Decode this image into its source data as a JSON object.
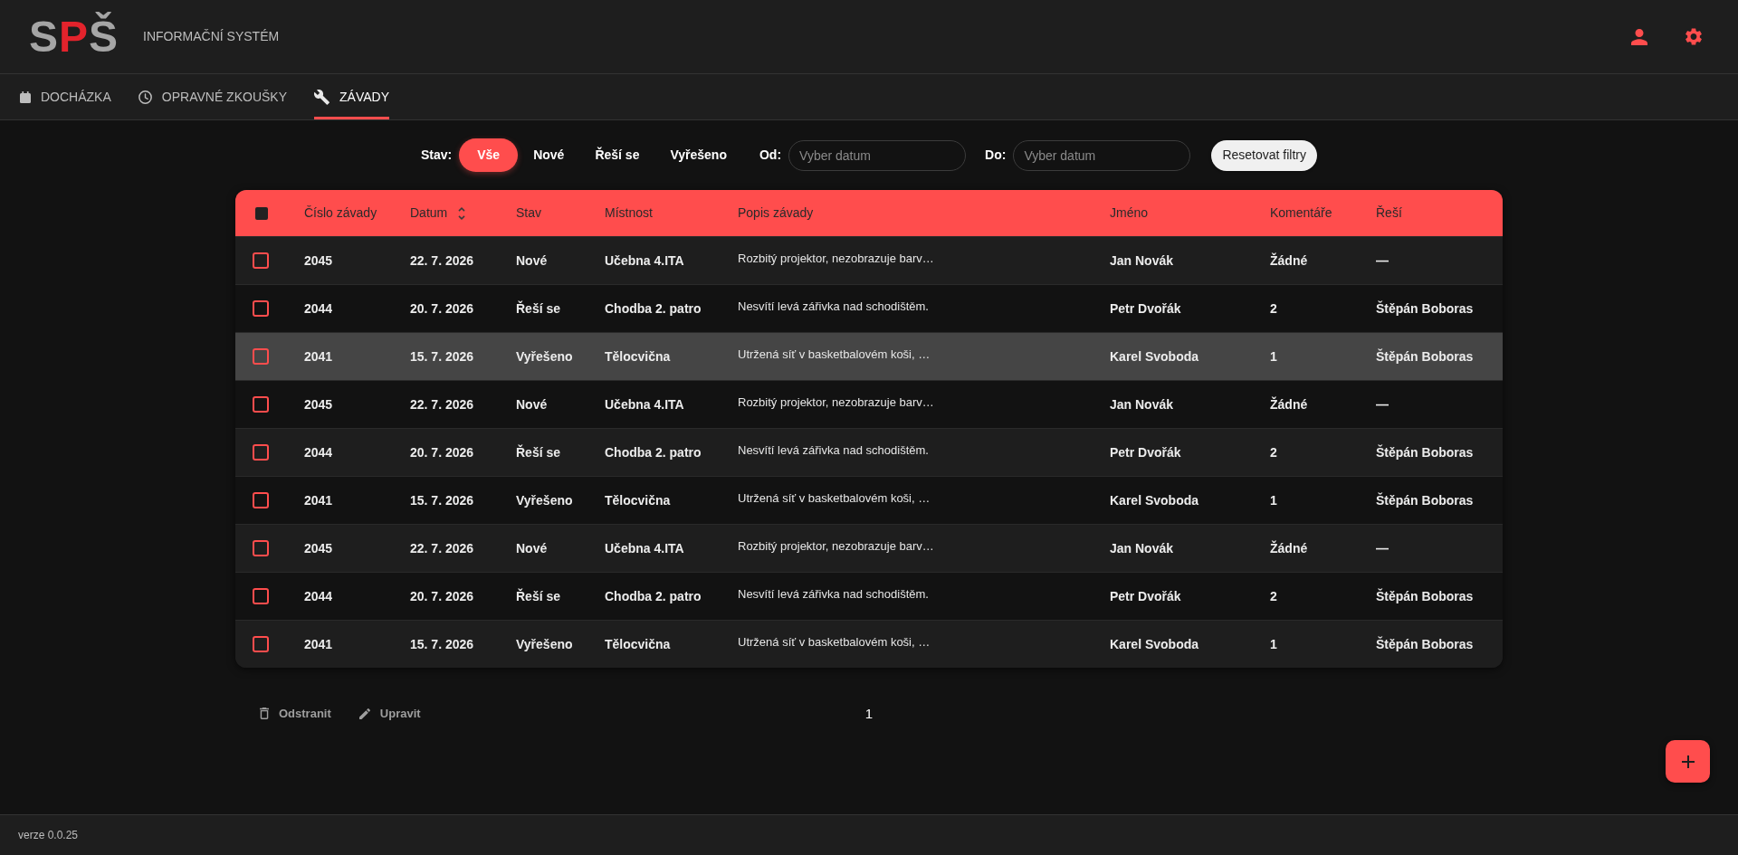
{
  "header": {
    "logo": [
      {
        "text": "S",
        "accent": false
      },
      {
        "text": "P",
        "accent": true
      },
      {
        "text": "Š",
        "accent": false
      }
    ],
    "title": "INFORMAČNÍ SYSTÉM"
  },
  "tabs": [
    {
      "label": "DOCHÁZKA",
      "kind": "calendar",
      "selected": false
    },
    {
      "label": "OPRAVNÉ ZKOUŠKY",
      "kind": "clock",
      "selected": false
    },
    {
      "label": "ZÁVADY",
      "kind": "wrench",
      "selected": true
    }
  ],
  "filters": {
    "status_label": "Stav:",
    "statuses": [
      {
        "label": "Vše",
        "selected": true
      },
      {
        "label": "Nové",
        "selected": false
      },
      {
        "label": "Řeší se",
        "selected": false
      },
      {
        "label": "Vyřešeno",
        "selected": false
      }
    ],
    "date_from": {
      "label": "Od:",
      "placeholder": "Vyber datum"
    },
    "date_to": {
      "label": "Do:",
      "placeholder": "Vyber datum"
    },
    "reset_button": "Resetovat filtry"
  },
  "table": {
    "select_all": {
      "checked": false
    },
    "columns": [
      {
        "label": "Číslo závady",
        "kind": "text",
        "sortable": false
      },
      {
        "label": "Datum",
        "kind": "text",
        "sortable": true
      },
      {
        "label": "Stav",
        "kind": "text",
        "sortable": false
      },
      {
        "label": "Místnost",
        "kind": "text",
        "sortable": false
      },
      {
        "label": "Popis závady",
        "kind": "description",
        "sortable": false
      },
      {
        "label": "Jméno",
        "kind": "text",
        "sortable": false
      },
      {
        "label": "Komentáře",
        "kind": "text",
        "sortable": false
      },
      {
        "label": "Řeší",
        "kind": "text",
        "sortable": false
      }
    ],
    "rows": [
      {
        "checked": false,
        "hovered": false,
        "cells": [
          "2045",
          "22. 7. 2026",
          "Nové",
          "Učebna 4.ITA",
          "Rozbitý projektor, nezobrazuje barv…",
          "Jan Novák",
          "Žádné",
          "—"
        ]
      },
      {
        "checked": false,
        "hovered": false,
        "cells": [
          "2044",
          "20. 7. 2026",
          "Řeší se",
          "Chodba 2. patro",
          "Nesvítí levá zářivka nad schodištěm.",
          "Petr Dvořák",
          "2",
          "Štěpán Boboras"
        ]
      },
      {
        "checked": false,
        "hovered": true,
        "cells": [
          "2041",
          "15. 7. 2026",
          "Vyřešeno",
          "Tělocvična",
          "Utržená síť v basketbalovém koši, …",
          "Karel Svoboda",
          "1",
          "Štěpán Boboras"
        ]
      },
      {
        "checked": false,
        "hovered": false,
        "cells": [
          "2045",
          "22. 7. 2026",
          "Nové",
          "Učebna 4.ITA",
          "Rozbitý projektor, nezobrazuje barv…",
          "Jan Novák",
          "Žádné",
          "—"
        ]
      },
      {
        "checked": false,
        "hovered": false,
        "cells": [
          "2044",
          "20. 7. 2026",
          "Řeší se",
          "Chodba 2. patro",
          "Nesvítí levá zářivka nad schodištěm.",
          "Petr Dvořák",
          "2",
          "Štěpán Boboras"
        ]
      },
      {
        "checked": false,
        "hovered": false,
        "cells": [
          "2041",
          "15. 7. 2026",
          "Vyřešeno",
          "Tělocvična",
          "Utržená síť v basketbalovém koši, …",
          "Karel Svoboda",
          "1",
          "Štěpán Boboras"
        ]
      },
      {
        "checked": false,
        "hovered": false,
        "cells": [
          "2045",
          "22. 7. 2026",
          "Nové",
          "Učebna 4.ITA",
          "Rozbitý projektor, nezobrazuje barv…",
          "Jan Novák",
          "Žádné",
          "—"
        ]
      },
      {
        "checked": false,
        "hovered": false,
        "cells": [
          "2044",
          "20. 7. 2026",
          "Řeší se",
          "Chodba 2. patro",
          "Nesvítí levá zářivka nad schodištěm.",
          "Petr Dvořák",
          "2",
          "Štěpán Boboras"
        ]
      },
      {
        "checked": false,
        "hovered": false,
        "cells": [
          "2041",
          "15. 7. 2026",
          "Vyřešeno",
          "Tělocvična",
          "Utržená síť v basketbalovém koši, …",
          "Karel Svoboda",
          "1",
          "Štěpán Boboras"
        ]
      }
    ]
  },
  "actions": [
    {
      "label": "Odstranit",
      "kind": "delete",
      "disabled": true
    },
    {
      "label": "Upravit",
      "kind": "edit",
      "disabled": true
    }
  ],
  "pagination": {
    "page": "1"
  },
  "footer": {
    "version": "verze 0.0.25"
  }
}
